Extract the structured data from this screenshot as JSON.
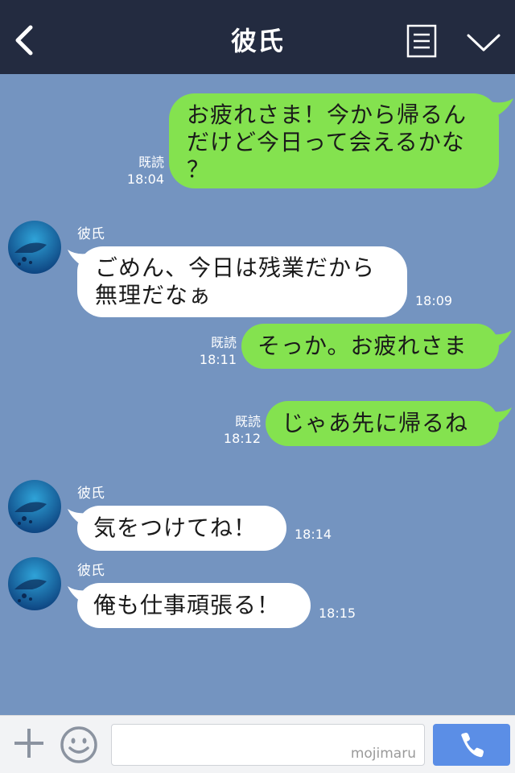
{
  "header": {
    "title": "彼氏"
  },
  "messages": [
    {
      "from": "me",
      "text": "お疲れさま！今から帰るん\nだけど今日って会えるかな\n？",
      "read": "既読",
      "time": "18:04"
    },
    {
      "from": "them",
      "sender": "彼氏",
      "text": "ごめん、今日は残業だから\n無理だなぁ",
      "time": "18:09"
    },
    {
      "from": "me",
      "text": "そっか。お疲れさま",
      "read": "既読",
      "time": "18:11"
    },
    {
      "from": "me",
      "text": "じゃあ先に帰るね",
      "read": "既読",
      "time": "18:12"
    },
    {
      "from": "them",
      "sender": "彼氏",
      "text": "気をつけてね！",
      "time": "18:14"
    },
    {
      "from": "them",
      "sender": "彼氏",
      "text": "俺も仕事頑張る！",
      "time": "18:15"
    }
  ],
  "footer": {
    "watermark": "mojimaru"
  },
  "icons": {
    "back": "chevron-left-icon",
    "menu": "list-icon",
    "collapse": "chevron-down-icon",
    "add": "plus-icon",
    "emoji": "smiley-icon",
    "call": "phone-icon"
  },
  "colors": {
    "background": "#7494c0",
    "header": "#232b40",
    "my_bubble": "#84e24f",
    "their_bubble": "#ffffff",
    "call_button": "#5b8ee6"
  }
}
